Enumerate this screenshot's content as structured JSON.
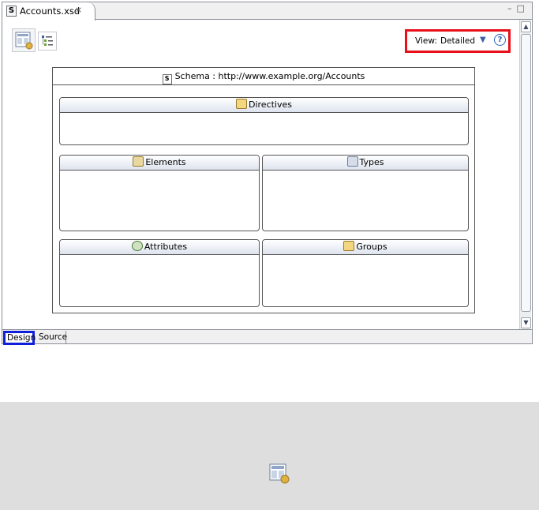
{
  "editor": {
    "tab_label": "Accounts.xsd",
    "tab_close": "⨯",
    "window_controls": "–□"
  },
  "toolbar": {
    "view_label": "View:",
    "view_value": "Detailed",
    "dropdown_arrow": "▼",
    "help": "?"
  },
  "schema": {
    "title": "Schema : http://www.example.org/Accounts",
    "sections": {
      "directives": "Directives",
      "elements": "Elements",
      "types": "Types",
      "attributes": "Attributes",
      "groups": "Groups"
    }
  },
  "bottom_tabs": {
    "design": "Design",
    "source": "Source"
  },
  "scrollbar": {
    "up": "▲",
    "down": "▼"
  },
  "colors": {
    "highlight_red": "#e8101a",
    "highlight_blue": "#1020d8",
    "header_gradient": "#dde3ee",
    "lower_background": "#dedede"
  }
}
